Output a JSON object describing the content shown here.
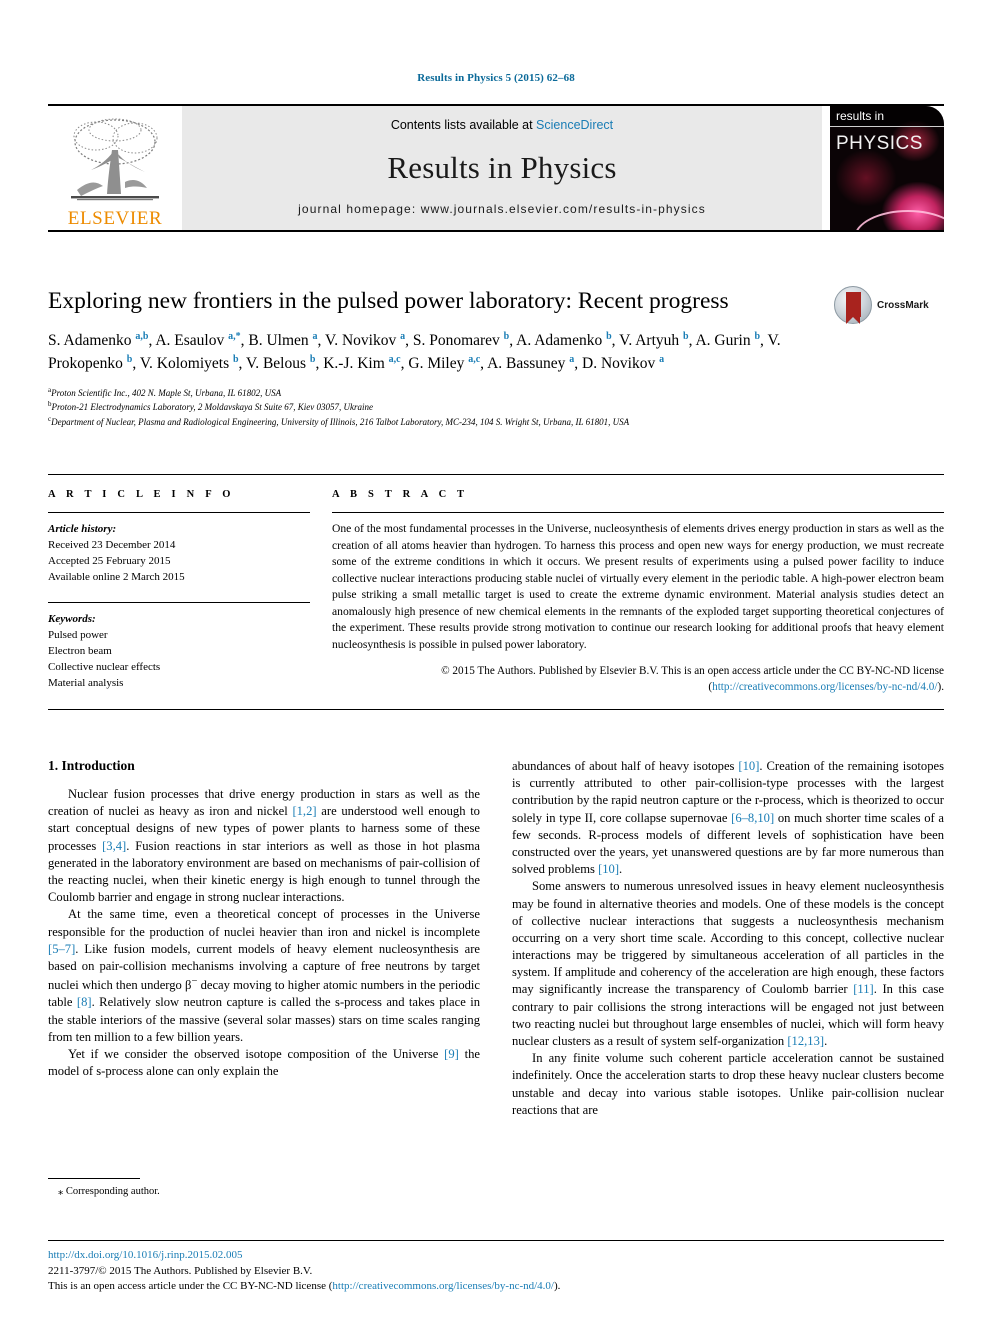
{
  "running_head": "Results in Physics 5 (2015) 62–68",
  "masthead": {
    "publisher_logo_label": "ELSEVIER",
    "contents_prefix": "Contents lists available at ",
    "contents_link": "ScienceDirect",
    "journal_name": "Results in Physics",
    "homepage_line": "journal homepage: www.journals.elsevier.com/results-in-physics",
    "cover": {
      "label_top": "results in",
      "label_main": "PHYSICS"
    }
  },
  "article": {
    "title": "Exploring new frontiers in the pulsed power laboratory: Recent progress",
    "crossmark_label": "CrossMark",
    "authors_html": "S. Adamenko <sup>a,b</sup>, A. Esaulov <sup>a,*</sup>, B. Ulmen <sup>a</sup>, V. Novikov <sup>a</sup>, S. Ponomarev <sup>b</sup>, A. Adamenko <sup>b</sup>, V. Artyuh <sup>b</sup>, A. Gurin <sup>b</sup>, V. Prokopenko <sup>b</sup>, V. Kolomiyets <sup>b</sup>, V. Belous <sup>b</sup>, K.-J. Kim <sup>a,c</sup>, G. Miley <sup>a,c</sup>, A. Bassuney <sup>a</sup>, D. Novikov <sup>a</sup>",
    "affiliations": [
      {
        "mark": "a",
        "text": "Proton Scientific Inc., 402 N. Maple St, Urbana, IL 61802, USA"
      },
      {
        "mark": "b",
        "text": "Proton-21 Electrodynamics Laboratory, 2 Moldavskaya St Suite 67, Kiev 03057, Ukraine"
      },
      {
        "mark": "c",
        "text": "Department of Nuclear, Plasma and Radiological Engineering, University of Illinois, 216 Talbot Laboratory, MC-234, 104 S. Wright St, Urbana, IL 61801, USA"
      }
    ]
  },
  "article_info": {
    "heading": "A R T I C L E    I N F O",
    "history_label": "Article history:",
    "history": [
      "Received 23 December 2014",
      "Accepted 25 February 2015",
      "Available online 2 March 2015"
    ],
    "keywords_label": "Keywords:",
    "keywords": [
      "Pulsed power",
      "Electron beam",
      "Collective nuclear effects",
      "Material analysis"
    ]
  },
  "abstract": {
    "heading": "A B S T R A C T",
    "text": "One of the most fundamental processes in the Universe, nucleosynthesis of elements drives energy production in stars as well as the creation of all atoms heavier than hydrogen. To harness this process and open new ways for energy production, we must recreate some of the extreme conditions in which it occurs. We present results of experiments using a pulsed power facility to induce collective nuclear interactions producing stable nuclei of virtually every element in the periodic table. A high-power electron beam pulse striking a small metallic target is used to create the extreme dynamic environment. Material analysis studies detect an anomalously high presence of new chemical elements in the remnants of the exploded target supporting theoretical conjectures of the experiment. These results provide strong motivation to continue our research looking for additional proofs that heavy element nucleosynthesis is possible in pulsed power laboratory.",
    "copyright_prefix": "© 2015 The Authors. Published by Elsevier B.V. This is an open access article under the CC BY-NC-ND license (",
    "copyright_link": "http://creativecommons.org/licenses/by-nc-nd/4.0/",
    "copyright_suffix": ")."
  },
  "body": {
    "section_heading": "1. Introduction",
    "left_paragraphs": [
      "Nuclear fusion processes that drive energy production in stars as well as the creation of nuclei as heavy as iron and nickel <span class=\"ref\">[1,2]</span> are understood well enough to start conceptual designs of new types of power plants to harness some of these processes <span class=\"ref\">[3,4]</span>. Fusion reactions in star interiors as well as those in hot plasma generated in the laboratory environment are based on mechanisms of pair-collision of the reacting nuclei, when their kinetic energy is high enough to tunnel through the Coulomb barrier and engage in strong nuclear interactions.",
      "At the same time, even a theoretical concept of processes in the Universe responsible for the production of nuclei heavier than iron and nickel is incomplete <span class=\"ref\">[5–7]</span>. Like fusion models, current models of heavy element nucleosynthesis are based on pair-collision mechanisms involving a capture of free neutrons by target nuclei which then undergo β<sup>−</sup> decay moving to higher atomic numbers in the periodic table <span class=\"ref\">[8]</span>. Relatively slow neutron capture is called the s-process and takes place in the stable interiors of the massive (several solar masses) stars on time scales ranging from ten million to a few billion years.",
      "Yet if we consider the observed isotope composition of the Universe <span class=\"ref\">[9]</span> the model of s-process alone can only explain the"
    ],
    "right_paragraphs": [
      "abundances of about half of heavy isotopes <span class=\"ref\">[10]</span>. Creation of the remaining isotopes is currently attributed to other pair-collision-type processes with the largest contribution by the rapid neutron capture or the r-process, which is theorized to occur solely in type II, core collapse supernovae <span class=\"ref\">[6–8,10]</span> on much shorter time scales of a few seconds. R-process models of different levels of sophistication have been constructed over the years, yet unanswered questions are by far more numerous than solved problems <span class=\"ref\">[10]</span>.",
      "Some answers to numerous unresolved issues in heavy element nucleosynthesis may be found in alternative theories and models. One of these models is the concept of collective nuclear interactions that suggests a nucleosynthesis mechanism occurring on a very short time scale. According to this concept, collective nuclear interactions may be triggered by simultaneous acceleration of all particles in the system. If amplitude and coherency of the acceleration are high enough, these factors may significantly increase the transparency of Coulomb barrier <span class=\"ref\">[11]</span>. In this case contrary to pair collisions the strong interactions will be engaged not just between two reacting nuclei but throughout large ensembles of nuclei, which will form heavy nuclear clusters as a result of system self-organization <span class=\"ref\">[12,13]</span>.",
      "In any finite volume such coherent particle acceleration cannot be sustained indefinitely. Once the acceleration starts to drop these heavy nuclear clusters become unstable and decay into various stable isotopes. Unlike pair-collision nuclear reactions that are"
    ]
  },
  "footnote": {
    "corresponding_author": "⁎ Corresponding author."
  },
  "footer": {
    "doi": "http://dx.doi.org/10.1016/j.rinp.2015.02.005",
    "issn_line": "2211-3797/© 2015 The Authors. Published by Elsevier B.V.",
    "license_prefix": "This is an open access article under the CC BY-NC-ND license (",
    "license_link": "http://creativecommons.org/licenses/by-nc-nd/4.0/",
    "license_suffix": ")."
  },
  "colors": {
    "link": "#1a7db5",
    "running_head": "#0b6a99",
    "elsevier_orange": "#ed8b00",
    "crossmark_red": "#a8231e"
  }
}
